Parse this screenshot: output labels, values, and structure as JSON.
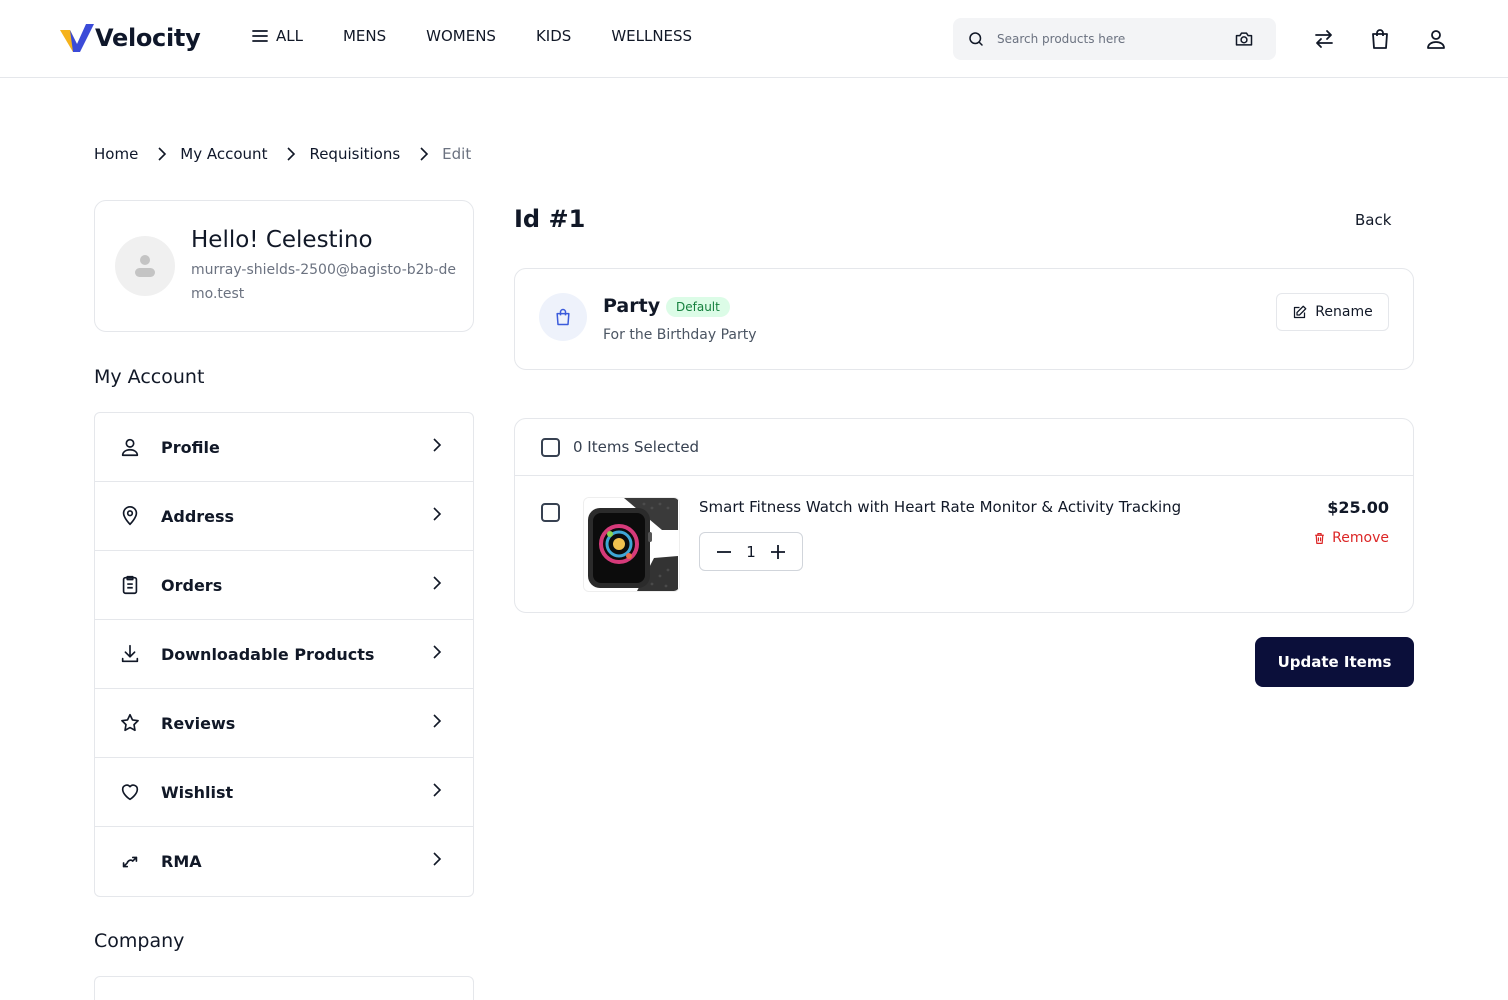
{
  "header": {
    "brand": "Velocity",
    "nav": [
      "ALL",
      "MENS",
      "WOMENS",
      "KIDS",
      "WELLNESS"
    ],
    "search_placeholder": "Search products here",
    "icons": [
      "compare-icon",
      "shopping-bag-icon",
      "user-icon"
    ]
  },
  "breadcrumb": [
    "Home",
    "My Account",
    "Requisitions",
    "Edit"
  ],
  "profile": {
    "greeting": "Hello! Celestino",
    "email": "murray-shields-2500@bagisto-b2b-demo.test"
  },
  "account_menu": {
    "title": "My Account",
    "items": [
      {
        "label": "Profile",
        "icon": "user-icon"
      },
      {
        "label": "Address",
        "icon": "location-pin-icon"
      },
      {
        "label": "Orders",
        "icon": "clipboard-icon"
      },
      {
        "label": "Downloadable Products",
        "icon": "download-icon"
      },
      {
        "label": "Reviews",
        "icon": "star-icon"
      },
      {
        "label": "Wishlist",
        "icon": "heart-icon"
      },
      {
        "label": "RMA",
        "icon": "return-arrows-icon"
      }
    ]
  },
  "company": {
    "title": "Company"
  },
  "requisition": {
    "id_label": "Id #1",
    "back_label": "Back",
    "name": "Party",
    "badge": "Default",
    "description": "For the Birthday Party",
    "rename_label": "Rename"
  },
  "items": {
    "selected_label": "0 Items Selected",
    "list": [
      {
        "name": "Smart Fitness Watch with Heart Rate Monitor & Activity Tracking",
        "price": "$25.00",
        "quantity": "1",
        "remove_label": "Remove"
      }
    ],
    "update_label": "Update Items"
  },
  "colors": {
    "primary": "#0b0f3a",
    "badge_bg": "#dcfce7",
    "badge_text": "#15803d",
    "remove": "#dc2626",
    "border": "#e5e7eb"
  }
}
